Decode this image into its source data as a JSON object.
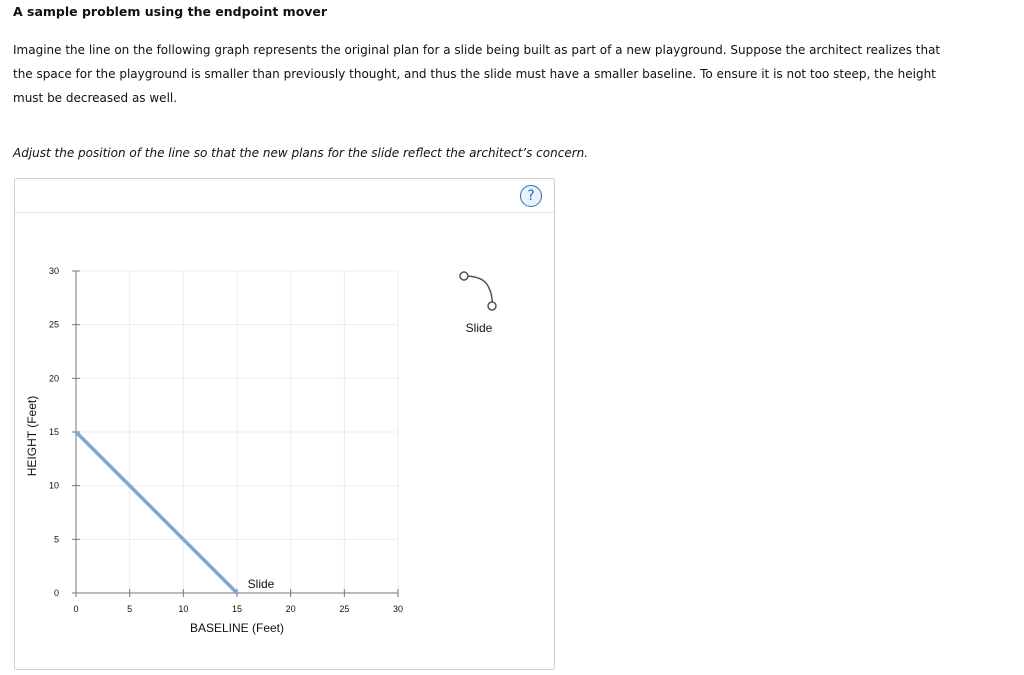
{
  "heading": "A sample problem using the endpoint mover",
  "paragraph": "Imagine the line on the following graph represents the original plan for a slide being built as part of a new playground. Suppose the architect realizes that the space for the playground is smaller than previously thought, and thus the slide must have a smaller baseline. To ensure it is not too steep, the height must be decreased as well.",
  "instruction": "Adjust the position of the line so that the new plans for the slide reflect the architect’s concern.",
  "help_label": "?",
  "palette": {
    "label": "Slide",
    "icon": "endpoint-mover-line-icon"
  },
  "colors": {
    "line": "#7fa9d2",
    "help": "#2f6fb3"
  },
  "chart_data": {
    "type": "line",
    "xlabel": "BASELINE (Feet)",
    "ylabel": "HEIGHT (Feet)",
    "xlim": [
      0,
      30
    ],
    "ylim": [
      0,
      30
    ],
    "xticks": [
      "0",
      "5",
      "10",
      "15",
      "20",
      "25",
      "30"
    ],
    "yticks": [
      "0",
      "5",
      "10",
      "15",
      "20",
      "25",
      "30"
    ],
    "grid": true,
    "series": [
      {
        "name": "Slide",
        "x": [
          0,
          15
        ],
        "y": [
          15,
          0
        ]
      }
    ]
  }
}
